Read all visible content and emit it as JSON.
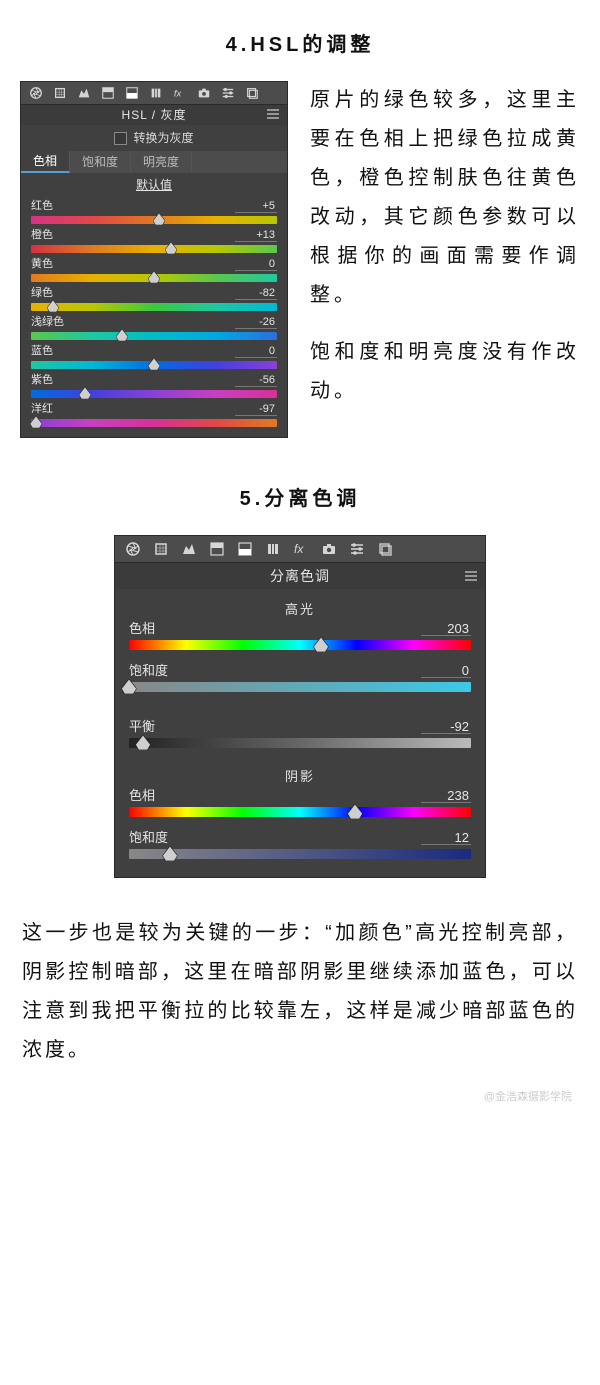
{
  "section4": {
    "heading": "4.HSL的调整",
    "side_para1": "原片的绿色较多，这里主要在色相上把绿色拉成黄色，橙色控制肤色往黄色改动，其它颜色参数可以根据你的画面需要作调整。",
    "side_para2": "饱和度和明亮度没有作改动。"
  },
  "hsl_panel": {
    "title": "HSL / 灰度",
    "checkbox_label": "转换为灰度",
    "tabs": {
      "hue": "色相",
      "sat": "饱和度",
      "lum": "明亮度"
    },
    "defaults": "默认值",
    "rows": [
      {
        "label": "红色",
        "value": "+5",
        "pos": 52,
        "grad": "g-red"
      },
      {
        "label": "橙色",
        "value": "+13",
        "pos": 57,
        "grad": "g-orange"
      },
      {
        "label": "黄色",
        "value": "0",
        "pos": 50,
        "grad": "g-yellow"
      },
      {
        "label": "绿色",
        "value": "-82",
        "pos": 9,
        "grad": "g-green"
      },
      {
        "label": "浅绿色",
        "value": "-26",
        "pos": 37,
        "grad": "g-aqua"
      },
      {
        "label": "蓝色",
        "value": "0",
        "pos": 50,
        "grad": "g-blue"
      },
      {
        "label": "紫色",
        "value": "-56",
        "pos": 22,
        "grad": "g-purple"
      },
      {
        "label": "洋红",
        "value": "-97",
        "pos": 2,
        "grad": "g-magenta"
      }
    ]
  },
  "section5": {
    "heading": "5.分离色调"
  },
  "split_panel": {
    "title": "分离色调",
    "highlights": "高光",
    "shadows": "阴影",
    "labels": {
      "hue": "色相",
      "sat": "饱和度",
      "balance": "平衡"
    },
    "hi_hue": {
      "value": "203",
      "pos": 56,
      "grad": "g-fullhue"
    },
    "hi_sat": {
      "value": "0",
      "pos": 0,
      "grad": "g-satcyan"
    },
    "balance": {
      "value": "-92",
      "pos": 4,
      "grad": "g-gray"
    },
    "sh_hue": {
      "value": "238",
      "pos": 66,
      "grad": "g-fullhue"
    },
    "sh_sat": {
      "value": "12",
      "pos": 12,
      "grad": "g-satblue"
    }
  },
  "body5": "这一步也是较为关键的一步：“加颜色”高光控制亮部，阴影控制暗部，这里在暗部阴影里继续添加蓝色，可以注意到我把平衡拉的比较靠左，这样是减少暗部蓝色的浓度。",
  "watermark": "@金浩森摄影学院"
}
